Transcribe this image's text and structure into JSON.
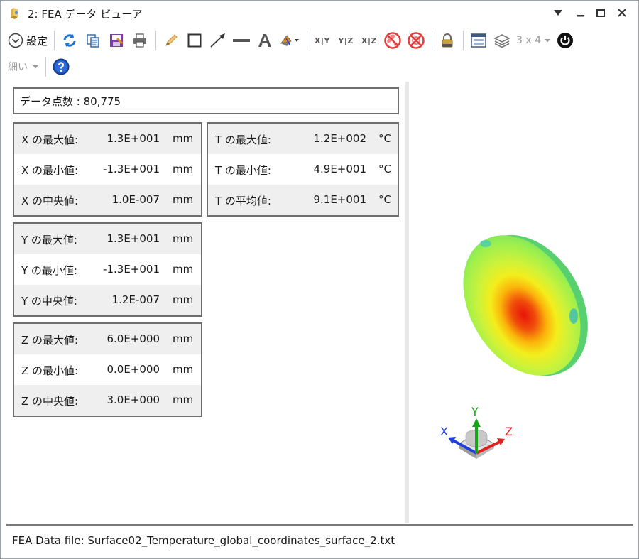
{
  "window": {
    "title": "2: FEA データ ビューア",
    "controls": {
      "menu_icon": "triangle-down-icon",
      "minimize_icon": "minimize-icon",
      "maximize_icon": "maximize-icon",
      "close_icon": "close-icon"
    }
  },
  "toolbar": {
    "settings_label": "設定",
    "layout_label": "3 x 4",
    "line_width_label": "細い",
    "axis_labels": {
      "xy": "X|Y",
      "yz": "Y|Z",
      "xz": "X|Z"
    }
  },
  "stats": {
    "point_count": "データ点数 : 80,775",
    "x": [
      {
        "label": "X の最大値:",
        "value": "1.3E+001",
        "unit": "mm"
      },
      {
        "label": "X の最小値:",
        "value": "-1.3E+001",
        "unit": "mm"
      },
      {
        "label": "X の中央値:",
        "value": "1.0E-007",
        "unit": "mm"
      }
    ],
    "t": [
      {
        "label": "T の最大値:",
        "value": "1.2E+002",
        "unit": "°C"
      },
      {
        "label": "T の最小値:",
        "value": "4.9E+001",
        "unit": "°C"
      },
      {
        "label": "T の平均値:",
        "value": "9.1E+001",
        "unit": "°C"
      }
    ],
    "y": [
      {
        "label": "Y の最大値:",
        "value": "1.3E+001",
        "unit": "mm"
      },
      {
        "label": "Y の最小値:",
        "value": "-1.3E+001",
        "unit": "mm"
      },
      {
        "label": "Y の中央値:",
        "value": "1.2E-007",
        "unit": "mm"
      }
    ],
    "z": [
      {
        "label": "Z の最大値:",
        "value": "6.0E+000",
        "unit": "mm"
      },
      {
        "label": "Z の最小値:",
        "value": "0.0E+000",
        "unit": "mm"
      },
      {
        "label": "Z の中央値:",
        "value": "3.0E+000",
        "unit": "mm"
      }
    ]
  },
  "triad": {
    "x": "X",
    "y": "Y",
    "z": "Z"
  },
  "status": {
    "file": "FEA Data file: Surface02_Temperature_global_coordinates_surface_2.txt"
  },
  "colors": {
    "x_axis": "#1f3fd6",
    "y_axis": "#1aa31a",
    "z_axis": "#e02020",
    "box_border": "#6e6e6e"
  }
}
